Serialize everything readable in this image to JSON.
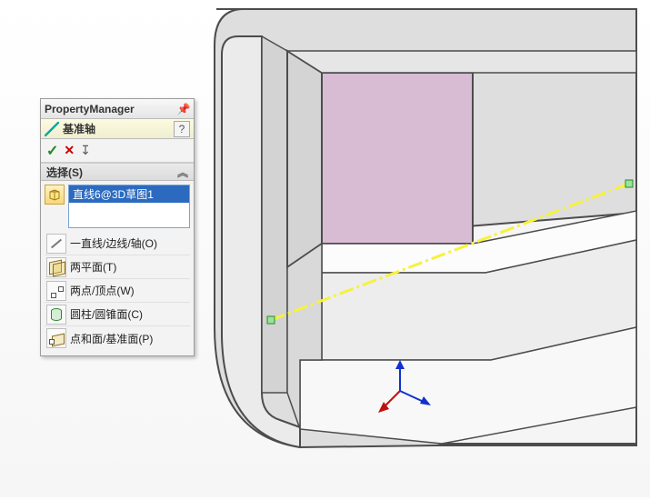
{
  "pm": {
    "title": "PropertyManager",
    "feature_name": "基准轴",
    "help": "?",
    "ok_glyph": "✓",
    "cancel_glyph": "✕",
    "pin_glyph": "↧"
  },
  "section": {
    "header": "选择(S)",
    "chevron": "︽",
    "selected_item": "直线6@3D草图1",
    "options": [
      {
        "label": "一直线/边线/轴(O)"
      },
      {
        "label": "两平面(T)"
      },
      {
        "label": "两点/顶点(W)"
      },
      {
        "label": "圆柱/圆锥面(C)"
      },
      {
        "label": "点和面/基准面(P)"
      }
    ]
  }
}
